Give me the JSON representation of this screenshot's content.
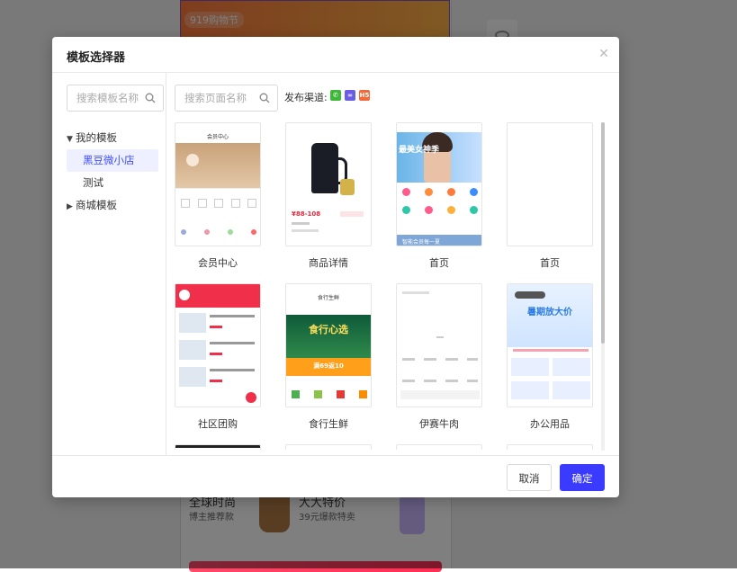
{
  "background": {
    "banner_label": "919购物节",
    "promo": {
      "title1": "全球时尚",
      "sub1": "博主推荐款",
      "title2": "大大特价",
      "sub2": "39元爆款特卖"
    }
  },
  "modal": {
    "title": "模板选择器",
    "close_icon": "close-icon",
    "template_search_placeholder": "搜索模板名称",
    "page_search_placeholder": "搜索页面名称",
    "channel_label": "发布渠道:",
    "channels": [
      {
        "name": "wechat",
        "color": "#3db839",
        "glyph": "✆"
      },
      {
        "name": "mini-program",
        "color": "#6b5ce7",
        "glyph": "∞"
      },
      {
        "name": "h5",
        "color": "#f26a3a",
        "glyph": "H5"
      }
    ],
    "tree": {
      "my_templates": "我的模板",
      "children": [
        "黑豆微小店",
        "测试"
      ],
      "mall_templates": "商城模板"
    },
    "cards": [
      {
        "label": "会员中心"
      },
      {
        "label": "商品详情"
      },
      {
        "label": "首页"
      },
      {
        "label": "首页"
      },
      {
        "label": "社区团购"
      },
      {
        "label": "食行生鲜"
      },
      {
        "label": "伊赛牛肉"
      },
      {
        "label": "办公用品"
      }
    ],
    "thumb_text": {
      "member_center": "会员中心",
      "price": "¥88-108",
      "fresh_title": "食行生鲜",
      "fresh_banner": "食行心选",
      "fresh_promo": "满69返10",
      "office_banner": "暑期放大价",
      "fashion_banner": "最美女神季",
      "fashion_footer": "智能会员每一夏"
    },
    "cancel_label": "取消",
    "ok_label": "确定",
    "accent_color": "#3b3bff"
  }
}
